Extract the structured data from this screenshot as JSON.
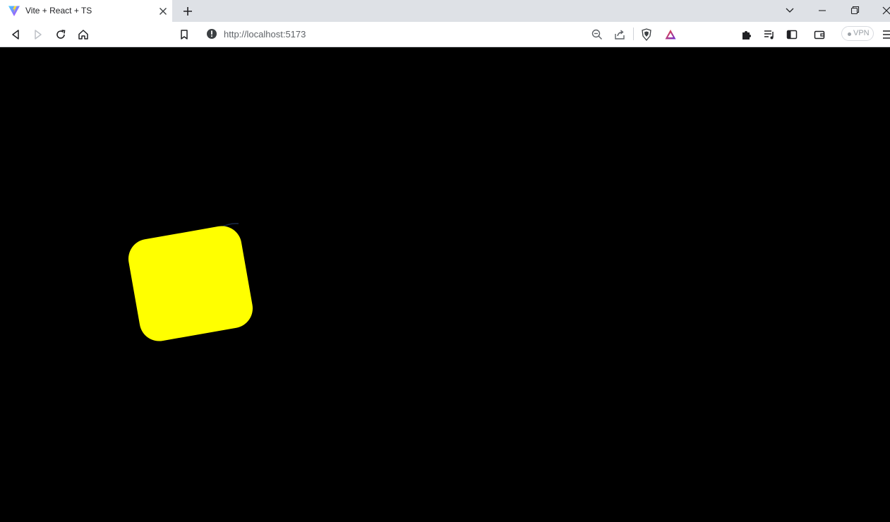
{
  "tab": {
    "title": "Vite + React + TS",
    "favicon_icon": "vite-logo-icon",
    "close_icon": "close-icon"
  },
  "tabstrip": {
    "new_tab_icon": "plus-icon",
    "tab_search_icon": "chevron-down-icon"
  },
  "window_controls": {
    "minimize_icon": "minimize-icon",
    "restore_icon": "restore-icon",
    "close_icon": "close-icon"
  },
  "toolbar": {
    "back_icon": "back-arrow-icon",
    "forward_icon": "forward-arrow-icon",
    "reload_icon": "reload-icon",
    "home_icon": "home-icon",
    "bookmark_icon": "bookmark-icon",
    "url": "http://localhost:5173",
    "zoom_icon": "zoom-out-icon",
    "share_icon": "share-icon",
    "shields_icon": "brave-shields-icon",
    "rewards_icon": "brave-rewards-icon",
    "extensions_icon": "puzzle-icon",
    "playlist_icon": "playlist-icon",
    "sidebar_icon": "sidebar-icon",
    "wallet_icon": "wallet-icon",
    "vpn_label": "VPN",
    "menu_icon": "hamburger-menu-icon"
  },
  "canvas": {
    "background_color": "#000000",
    "shape_color": "#ffff00",
    "shape_rotation_deg": -10,
    "arc_color": "#1a2a4a"
  }
}
